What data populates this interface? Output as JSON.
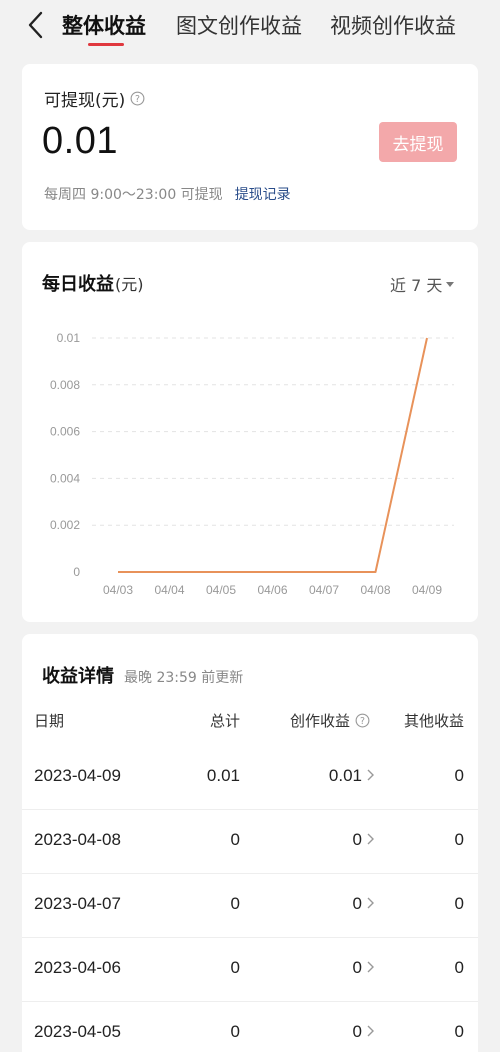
{
  "header": {
    "tabs": [
      {
        "label": "整体收益",
        "active": true
      },
      {
        "label": "图文创作收益",
        "active": false
      },
      {
        "label": "视频创作收益",
        "active": false
      }
    ],
    "accent_color": "#e0383e"
  },
  "balance_card": {
    "label": "可提现(元)",
    "amount": "0.01",
    "withdraw_button": "去提现",
    "note": "每周四 9:00～23:00 可提现",
    "records_link": "提现记录"
  },
  "daily_chart": {
    "title": "每日收益",
    "unit": "(元)",
    "range_label": "近 7 天"
  },
  "chart_data": {
    "type": "line",
    "title": "每日收益(元)",
    "categories": [
      "04/03",
      "04/04",
      "04/05",
      "04/06",
      "04/07",
      "04/08",
      "04/09"
    ],
    "series": [
      {
        "values": [
          0,
          0,
          0,
          0,
          0,
          0,
          0.01
        ],
        "color": "#e8925a"
      }
    ],
    "ylim": [
      0,
      0.01
    ],
    "yticks": [
      "0",
      "0.002",
      "0.004",
      "0.006",
      "0.008",
      "0.01"
    ],
    "grid": true
  },
  "details": {
    "title": "收益详情",
    "subtitle": "最晚 23:59 前更新",
    "columns": {
      "date": "日期",
      "total": "总计",
      "creation": "创作收益",
      "other": "其他收益"
    },
    "rows": [
      {
        "date": "2023-04-09",
        "total": "0.01",
        "creation": "0.01",
        "other": "0"
      },
      {
        "date": "2023-04-08",
        "total": "0",
        "creation": "0",
        "other": "0"
      },
      {
        "date": "2023-04-07",
        "total": "0",
        "creation": "0",
        "other": "0"
      },
      {
        "date": "2023-04-06",
        "total": "0",
        "creation": "0",
        "other": "0"
      },
      {
        "date": "2023-04-05",
        "total": "0",
        "creation": "0",
        "other": "0"
      }
    ]
  }
}
